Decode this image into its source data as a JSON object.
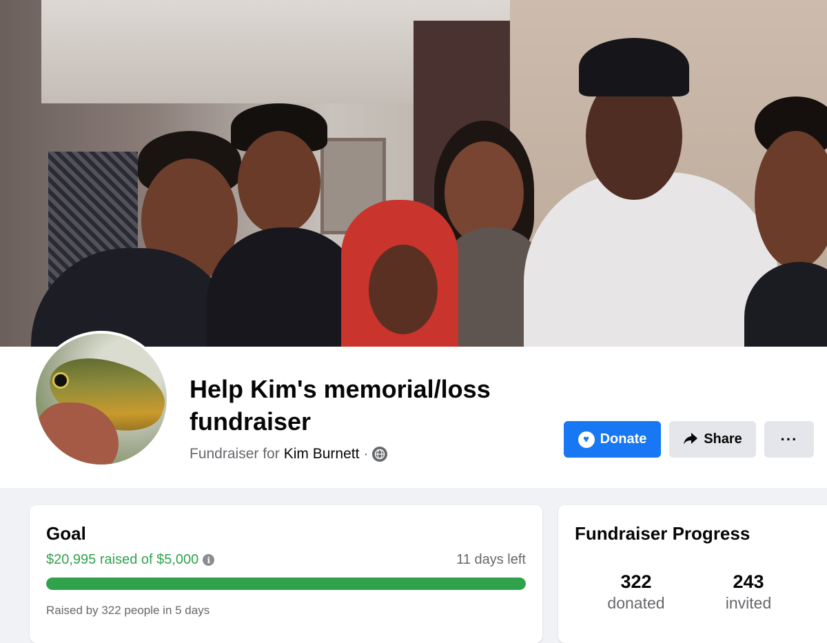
{
  "fundraiser": {
    "title": "Help Kim's memorial/loss fundraiser",
    "subtitle_prefix": "Fundraiser for",
    "beneficiary": "Kim Burnett",
    "separator": "·"
  },
  "actions": {
    "donate_label": "Donate",
    "share_label": "Share",
    "more_label": "···"
  },
  "goal_card": {
    "heading": "Goal",
    "raised_text": "$20,995 raised of $5,000",
    "days_left": "11 days left",
    "progress_fraction": 1.0,
    "raised_by": "Raised by 322 people in 5 days"
  },
  "progress_card": {
    "heading": "Fundraiser Progress",
    "stats": [
      {
        "value": "322",
        "label": "donated"
      },
      {
        "value": "243",
        "label": "invited"
      }
    ]
  },
  "icons": {
    "donate": "heart-icon",
    "share": "share-arrow-icon",
    "info": "info-icon",
    "privacy": "globe-icon"
  },
  "colors": {
    "primary": "#1877f2",
    "success": "#31a24c",
    "secondary_button": "#e4e6eb"
  }
}
